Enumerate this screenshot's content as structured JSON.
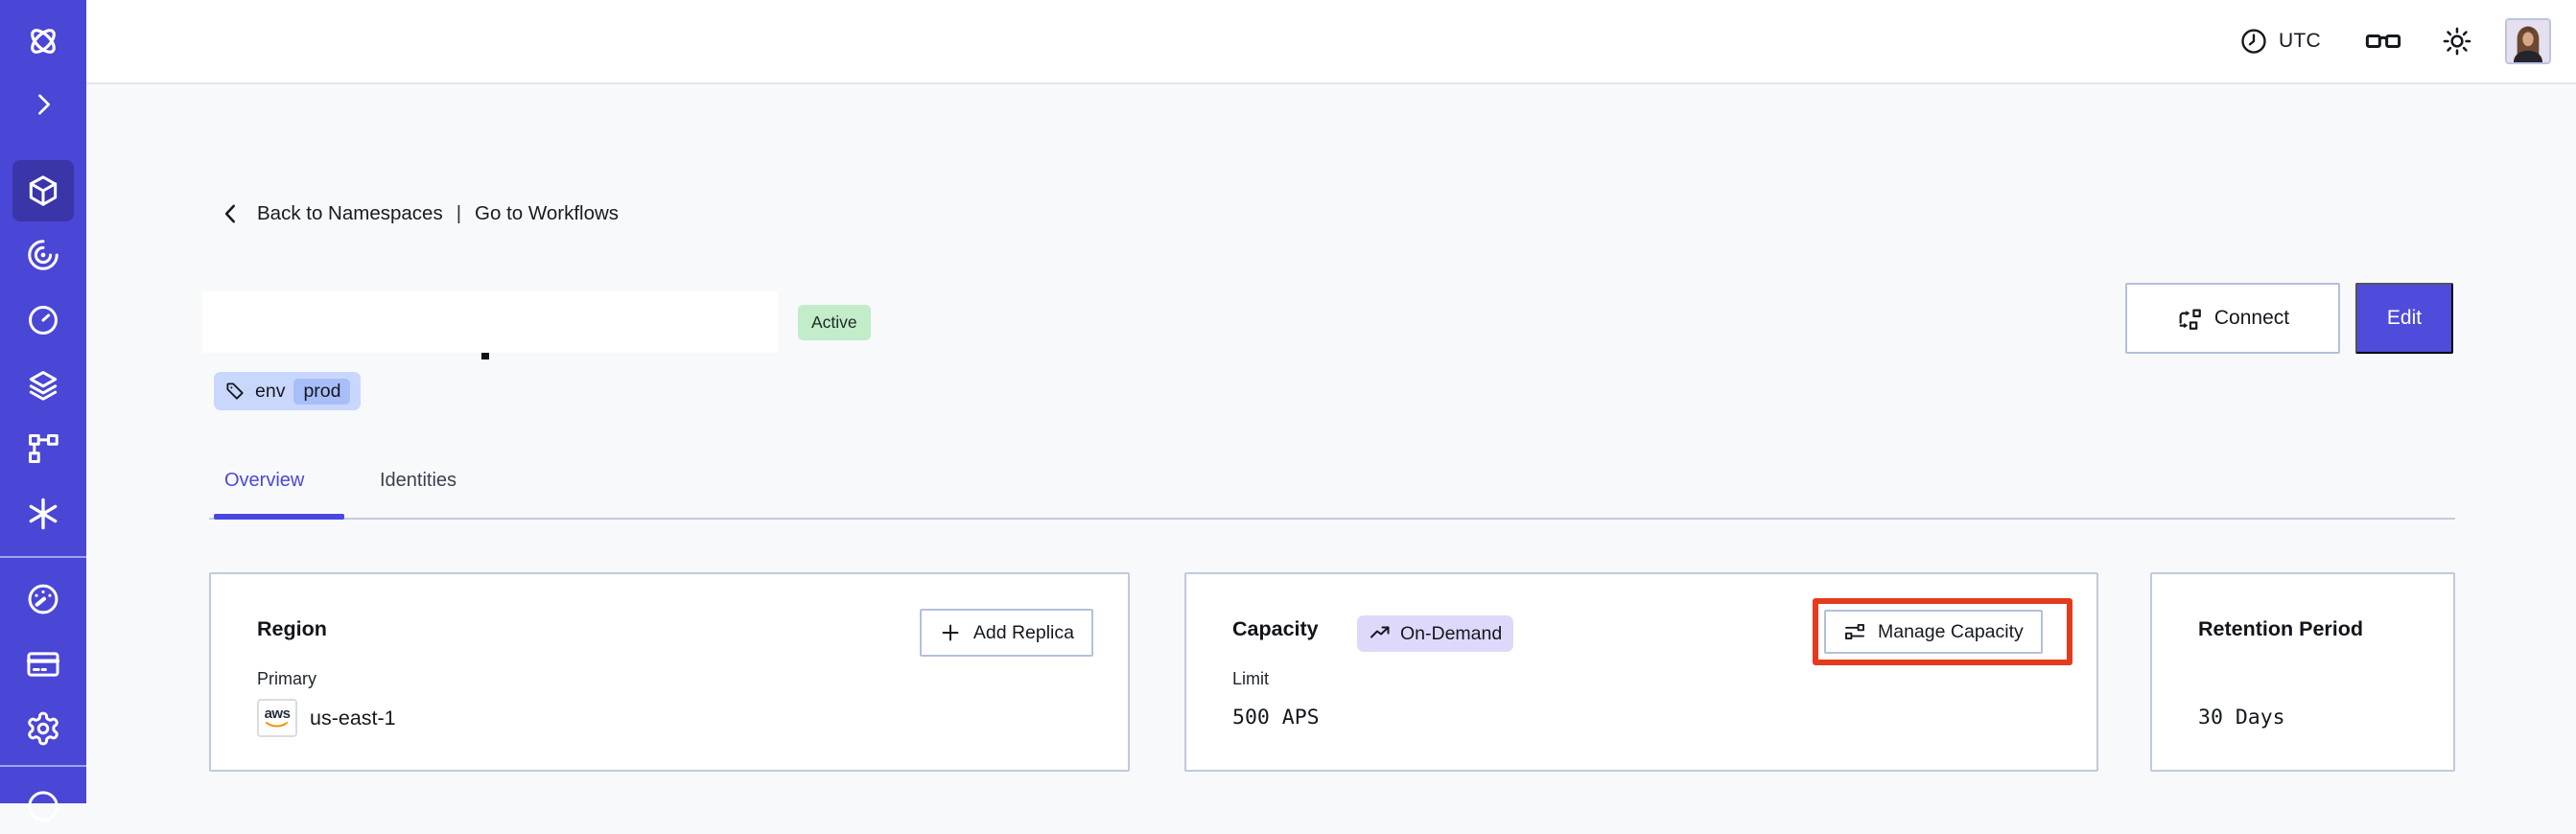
{
  "topbar": {
    "timezone_label": "UTC"
  },
  "sidebar": {
    "icons": [
      "temporal-logo",
      "expand-chevron",
      "namespaces-cube",
      "workflows-spiral",
      "schedules-clock",
      "deployments-layers",
      "batch-branch",
      "nexus-asterisk",
      "usage-gauge",
      "billing-card",
      "settings-gear",
      "support-globe"
    ],
    "active_icon": "namespaces-cube"
  },
  "main": {
    "breadcrumb": {
      "back_label": "Back to Namespaces",
      "separator": "|",
      "forward_label": "Go to Workflows"
    },
    "namespace": {
      "status_badge": "Active",
      "tag": {
        "key": "env",
        "value": "prod"
      }
    },
    "actions": {
      "connect_label": "Connect",
      "edit_label": "Edit"
    },
    "tabs": [
      {
        "label": "Overview",
        "active": true
      },
      {
        "label": "Identities",
        "active": false
      }
    ],
    "cards": {
      "region": {
        "title": "Region",
        "action_label": "Add Replica",
        "label": "Primary",
        "provider": "aws",
        "value": "us-east-1"
      },
      "capacity": {
        "title": "Capacity",
        "badge_label": "On-Demand",
        "action_label": "Manage Capacity",
        "label": "Limit",
        "value": "500 APS",
        "highlighted": true
      },
      "retention": {
        "title": "Retention Period",
        "value": "30 Days"
      }
    }
  },
  "colors": {
    "sidebar": "#4a46d6",
    "sidebar_active": "#3a35a8",
    "accent": "#4f4cdb",
    "tab_active": "#4a47e0",
    "status_badge_bg": "#c2ecca",
    "tag_bg": "#c9d7fd",
    "tag_chip_bg": "#a8bef9",
    "ondemand_bg": "#ded9fb",
    "highlight_red": "#e53a1e",
    "card_border": "#bfcadd"
  }
}
